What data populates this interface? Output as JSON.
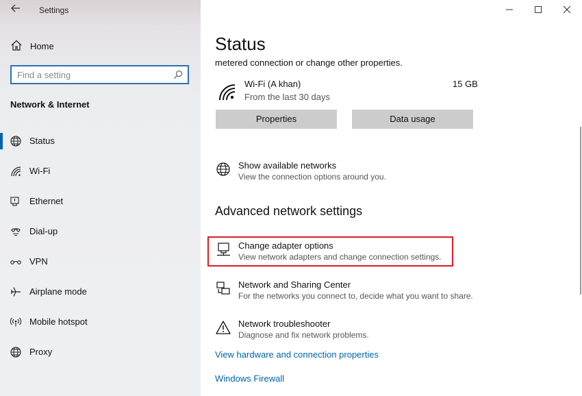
{
  "window": {
    "title": "Settings",
    "controls": [
      "minimize",
      "maximize",
      "close"
    ]
  },
  "sidebar": {
    "home_label": "Home",
    "search": {
      "placeholder": "Find a setting",
      "value": ""
    },
    "section_title": "Network & Internet",
    "items": [
      {
        "label": "Status",
        "icon": "globe-icon",
        "selected": true
      },
      {
        "label": "Wi-Fi",
        "icon": "wifi-icon",
        "selected": false
      },
      {
        "label": "Ethernet",
        "icon": "ethernet-icon",
        "selected": false
      },
      {
        "label": "Dial-up",
        "icon": "dialup-icon",
        "selected": false
      },
      {
        "label": "VPN",
        "icon": "vpn-icon",
        "selected": false
      },
      {
        "label": "Airplane mode",
        "icon": "airplane-icon",
        "selected": false
      },
      {
        "label": "Mobile hotspot",
        "icon": "hotspot-icon",
        "selected": false
      },
      {
        "label": "Proxy",
        "icon": "globe-icon",
        "selected": false
      }
    ]
  },
  "main": {
    "title": "Status",
    "clipped_text": "metered connection or change other properties.",
    "network": {
      "name": "Wi-Fi (A khan)",
      "subtitle": "From the last 30 days",
      "usage": "15 GB"
    },
    "buttons": {
      "properties": "Properties",
      "data_usage": "Data usage"
    },
    "show_networks": {
      "title": "Show available networks",
      "subtitle": "View the connection options around you."
    },
    "advanced_title": "Advanced network settings",
    "options": [
      {
        "title": "Change adapter options",
        "subtitle": "View network adapters and change connection settings.",
        "icon": "adapter-icon",
        "highlighted": true
      },
      {
        "title": "Network and Sharing Center",
        "subtitle": "For the networks you connect to, decide what you want to share.",
        "icon": "sharing-center-icon",
        "highlighted": false
      },
      {
        "title": "Network troubleshooter",
        "subtitle": "Diagnose and fix network problems.",
        "icon": "warning-icon",
        "highlighted": false
      }
    ],
    "links": [
      "View hardware and connection properties",
      "Windows Firewall"
    ]
  },
  "colors": {
    "accent": "#0063b1",
    "highlight": "#d81f26",
    "button": "#cccccc"
  }
}
